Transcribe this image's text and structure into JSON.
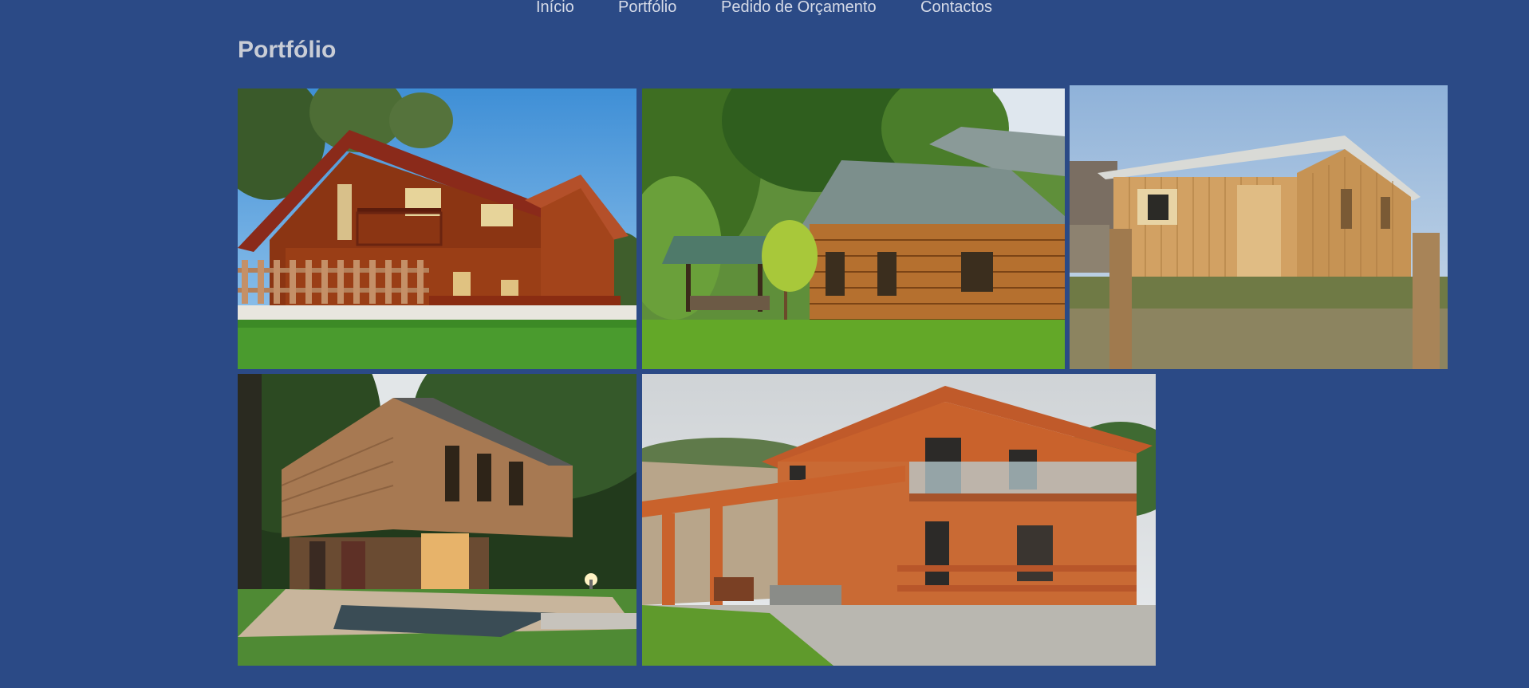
{
  "nav": {
    "items": [
      {
        "label": "Início"
      },
      {
        "label": "Portfólio"
      },
      {
        "label": "Pedido de Orçamento"
      },
      {
        "label": "Contactos"
      }
    ]
  },
  "page": {
    "title": "Portfólio"
  },
  "gallery": {
    "photos": [
      {
        "subject": "red-brown two-storey wooden chalet with balconies and picket fence"
      },
      {
        "subject": "log cabin with grey metal roof in a green forest"
      },
      {
        "subject": "unfinished pine plank house with corrugated roof"
      },
      {
        "subject": "modern timber-clad house with pond at dusk"
      },
      {
        "subject": "orange two-storey wooden house with glass balcony and terrace"
      }
    ]
  },
  "colors": {
    "background": "#2b4a86",
    "nav_text": "#d6dbe8",
    "title_text": "#c9cdd6"
  }
}
